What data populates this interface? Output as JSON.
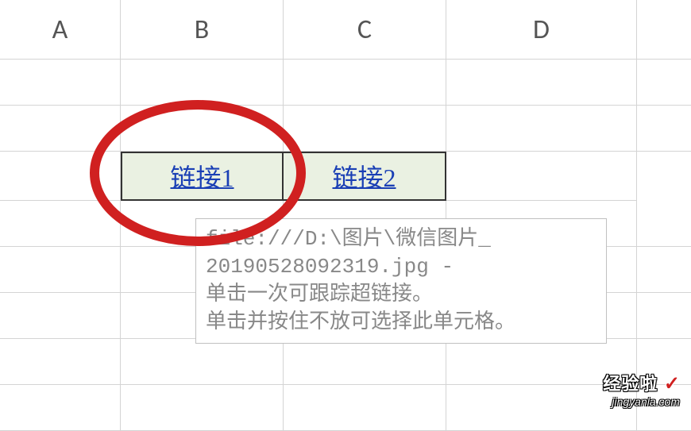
{
  "columns": {
    "A": "A",
    "B": "B",
    "C": "C",
    "D": "D"
  },
  "cells": {
    "B3": "链接1",
    "C3": "链接2"
  },
  "tooltip": {
    "line1": "file:///D:\\图片\\微信图片_",
    "line2": "20190528092319.jpg -",
    "line3": "单击一次可跟踪超链接。",
    "line4": "单击并按住不放可选择此单元格。"
  },
  "watermark": {
    "title": "经验啦",
    "sub": "jingyanla.com"
  }
}
